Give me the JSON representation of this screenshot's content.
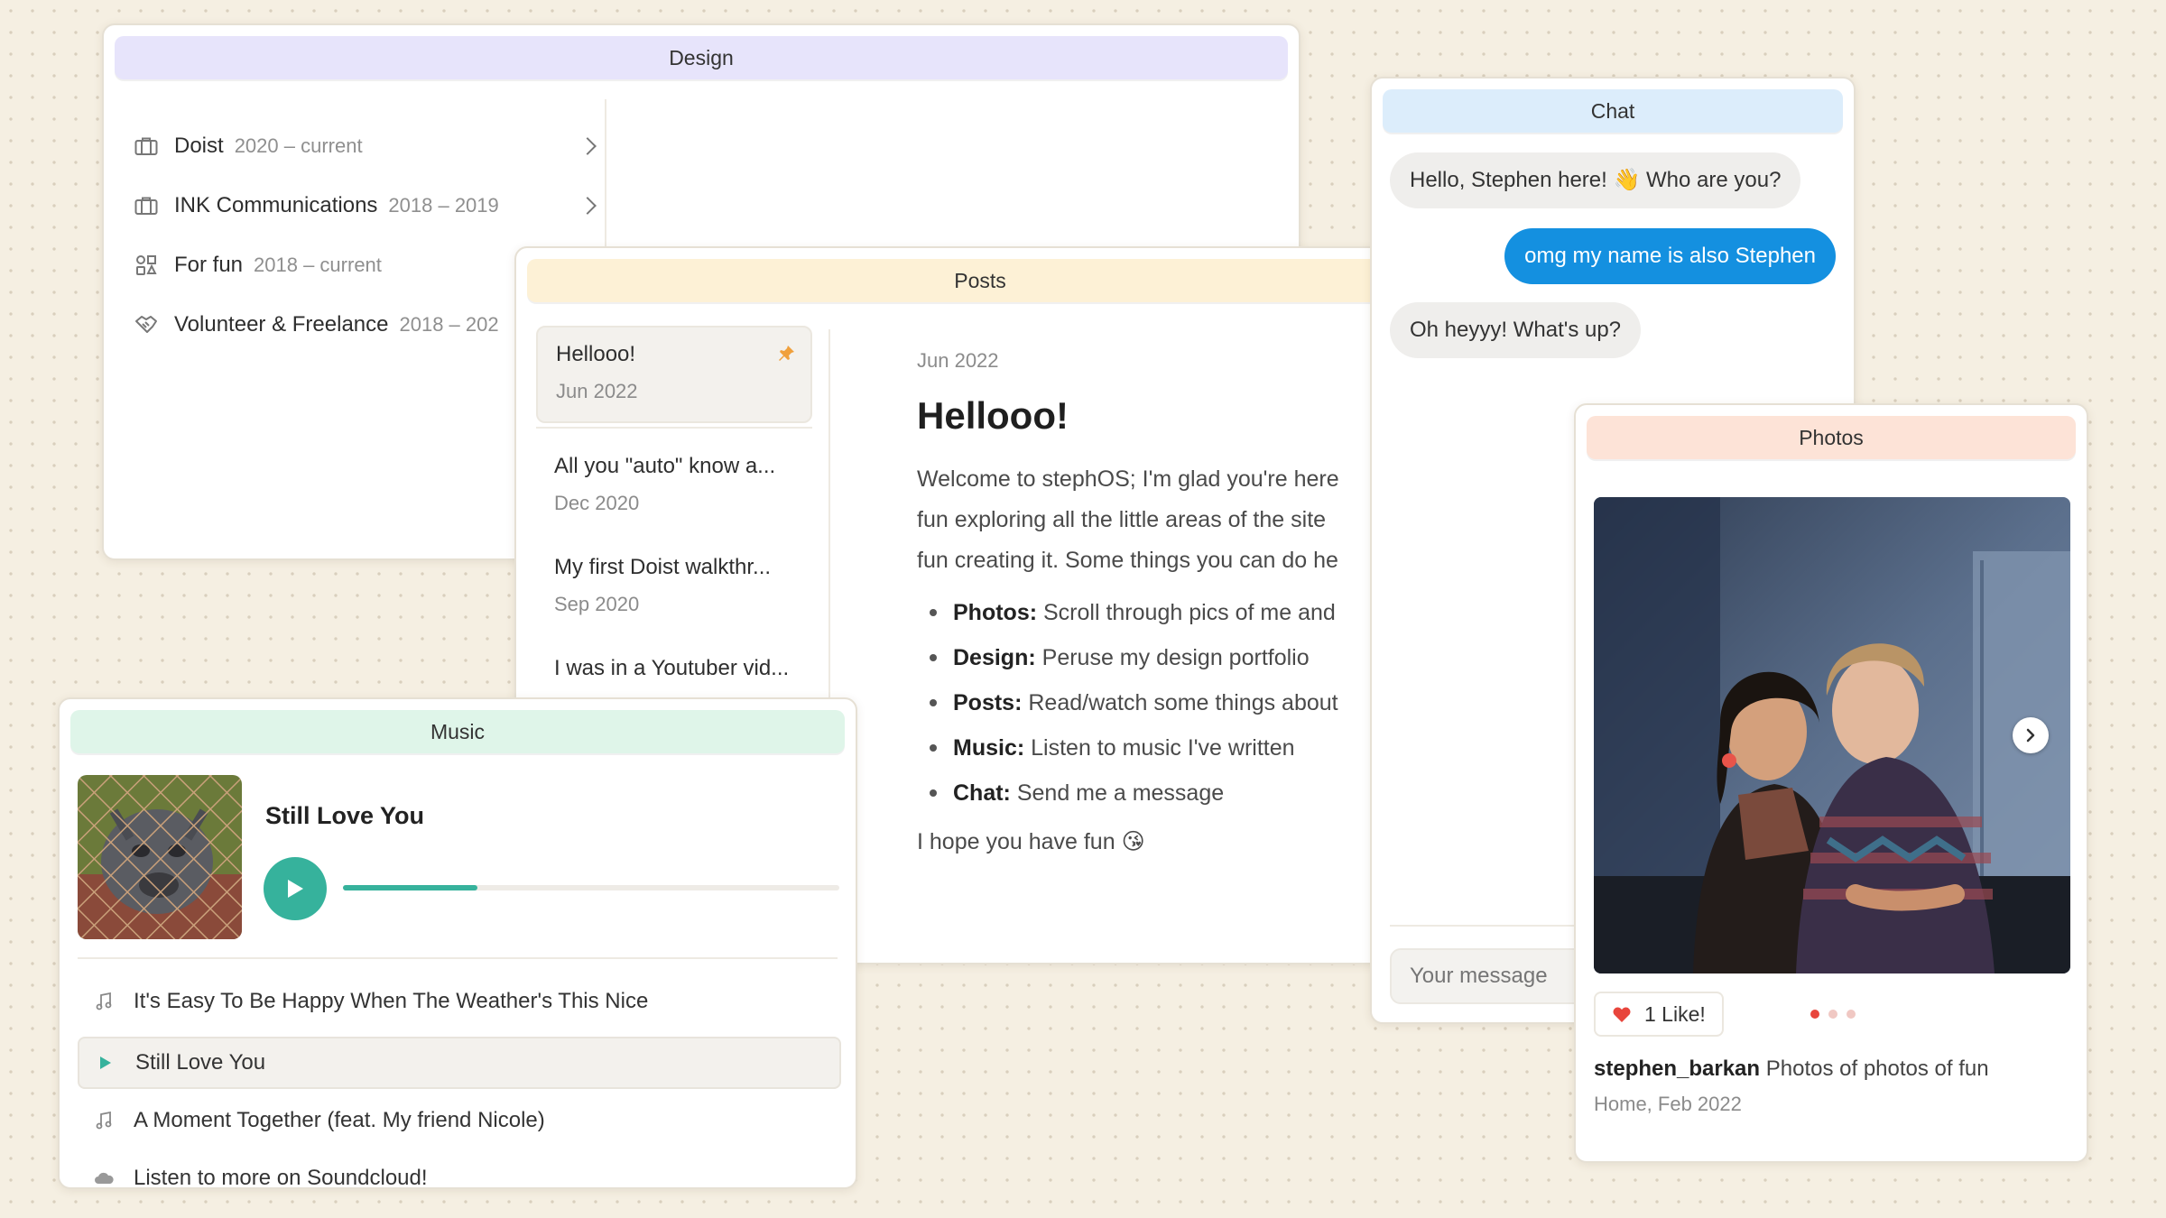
{
  "design": {
    "title": "Design",
    "items": [
      {
        "name": "Doist",
        "years": "2020 – current",
        "icon": "briefcase-icon"
      },
      {
        "name": "INK Communications",
        "years": "2018 – 2019",
        "icon": "briefcase-icon"
      },
      {
        "name": "For fun",
        "years": "2018 – current",
        "icon": "shapes-icon"
      },
      {
        "name": "Volunteer & Freelance",
        "years": "2018 – 202",
        "icon": "handshake-icon"
      }
    ]
  },
  "posts": {
    "title": "Posts",
    "list": [
      {
        "title": "Hellooo!",
        "date": "Jun 2022",
        "pinned": true
      },
      {
        "title": "All you \"auto\" know a...",
        "date": "Dec 2020"
      },
      {
        "title": "My first Doist walkthr...",
        "date": "Sep 2020"
      },
      {
        "title": "I was in a Youtuber vid...",
        "date": ""
      }
    ],
    "article": {
      "date": "Jun 2022",
      "heading": "Hellooo!",
      "intro_lines": [
        "Welcome to stephOS; I'm glad you're here",
        "fun exploring all the little areas of the site",
        "fun creating it. Some things you can do he"
      ],
      "bullets": [
        {
          "label": "Photos:",
          "text": "Scroll through pics of me and"
        },
        {
          "label": "Design:",
          "text": "Peruse my design portfolio"
        },
        {
          "label": "Posts:",
          "text": "Read/watch some things about"
        },
        {
          "label": "Music:",
          "text": "Listen to music I've written"
        },
        {
          "label": "Chat:",
          "text": "Send me a message"
        }
      ],
      "outro": "I hope you have fun 😘"
    }
  },
  "chat": {
    "title": "Chat",
    "messages": [
      {
        "from": "them",
        "text": "Hello, Stephen here! 👋 Who are you?"
      },
      {
        "from": "me",
        "text": "omg my name is also Stephen"
      },
      {
        "from": "them",
        "text": "Oh heyyy! What's up?"
      }
    ],
    "input_placeholder": "Your message"
  },
  "photos": {
    "title": "Photos",
    "likes": "1 Like!",
    "page_count": 3,
    "current_page": 1,
    "username": "stephen_barkan",
    "caption": "Photos of photos of fun",
    "location": "Home, Feb 2022"
  },
  "music": {
    "title": "Music",
    "now_playing": "Still Love You",
    "progress": 0.27,
    "accent_color": "#36b29c",
    "tracks": [
      {
        "title": "It's Easy To Be Happy When The Weather's This Nice",
        "state": "idle"
      },
      {
        "title": "Still Love You",
        "state": "playing"
      },
      {
        "title": "A Moment Together (feat. My friend Nicole)",
        "state": "idle"
      },
      {
        "title": "Listen to more on Soundcloud!",
        "state": "link"
      }
    ]
  }
}
